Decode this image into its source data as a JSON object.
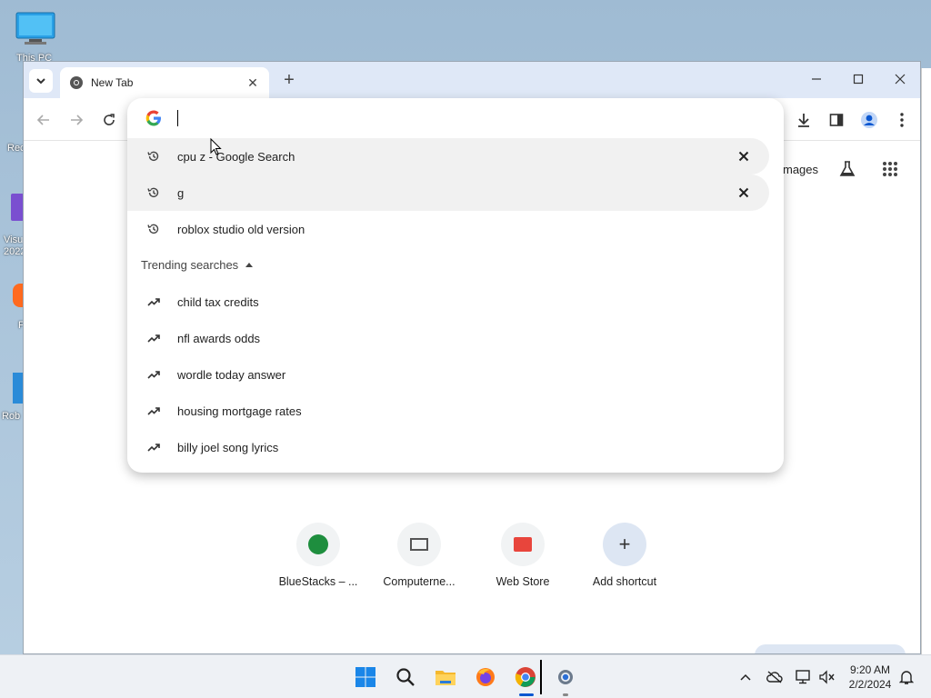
{
  "desktop": {
    "icons": [
      {
        "label": "This PC"
      },
      {
        "label": "Rec"
      },
      {
        "label": "Visu\n2022"
      },
      {
        "label": "F"
      },
      {
        "label": "Rob"
      }
    ]
  },
  "browser": {
    "tab": {
      "title": "New Tab"
    },
    "window_controls": {
      "minimize": "minimize",
      "maximize": "maximize",
      "close": "close"
    }
  },
  "omnibox": {
    "input_value": "",
    "history": [
      {
        "text": "cpu z - Google Search",
        "icon": "history-icon",
        "removable": true
      },
      {
        "text": "g",
        "icon": "history-icon",
        "removable": true
      },
      {
        "text": "roblox studio old version",
        "icon": "history-icon",
        "removable": false
      }
    ],
    "trending_header": "Trending searches",
    "trending": [
      {
        "text": "child tax credits",
        "icon": "trending-icon"
      },
      {
        "text": "nfl awards odds",
        "icon": "trending-icon"
      },
      {
        "text": "wordle today answer",
        "icon": "trending-icon"
      },
      {
        "text": "housing mortgage rates",
        "icon": "trending-icon"
      },
      {
        "text": "billy joel song lyrics",
        "icon": "trending-icon"
      }
    ]
  },
  "ntp": {
    "images_link": "mages",
    "shortcuts": [
      {
        "label": "BlueStacks – ..."
      },
      {
        "label": "Computerne..."
      },
      {
        "label": "Web Store"
      },
      {
        "label": "Add shortcut"
      }
    ]
  },
  "taskbar": {
    "time": "9:20 AM",
    "date": "2/2/2024"
  },
  "colors": {
    "accent": "#0b57d0",
    "titlebar": "#dfe8f7",
    "taskbar": "#eef1f5"
  }
}
